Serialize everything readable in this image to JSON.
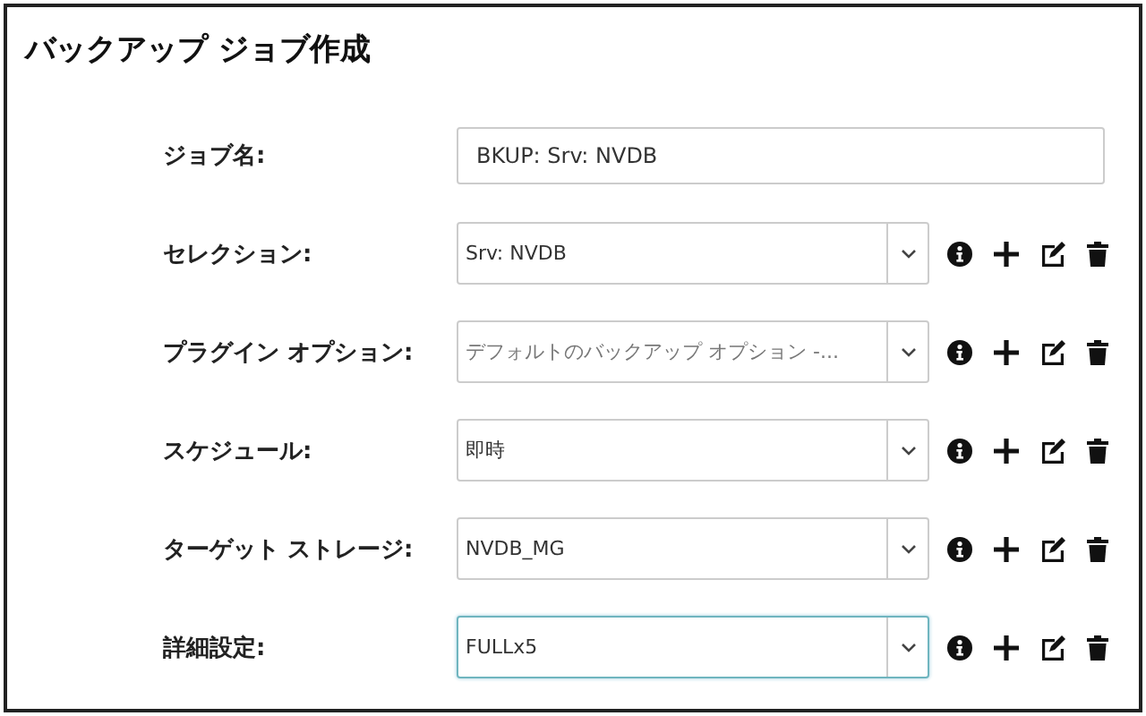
{
  "title": "バックアップ ジョブ作成",
  "fields": [
    {
      "kind": "text",
      "label": "ジョブ名:",
      "value": "BKUP: Srv: NVDB",
      "focused": false
    },
    {
      "kind": "select",
      "label": "セレクション:",
      "value": "Srv: NVDB",
      "focused": false,
      "muted": false
    },
    {
      "kind": "select",
      "label": "プラグイン オプション:",
      "value": "デフォルトのバックアップ オプション -...",
      "focused": false,
      "muted": true
    },
    {
      "kind": "select",
      "label": "スケジュール:",
      "value": "即時",
      "focused": false,
      "muted": false
    },
    {
      "kind": "select",
      "label": "ターゲット ストレージ:",
      "value": "NVDB_MG",
      "focused": false,
      "muted": false
    },
    {
      "kind": "select",
      "label": "詳細設定:",
      "value": "FULLx5",
      "focused": true,
      "muted": false
    }
  ]
}
